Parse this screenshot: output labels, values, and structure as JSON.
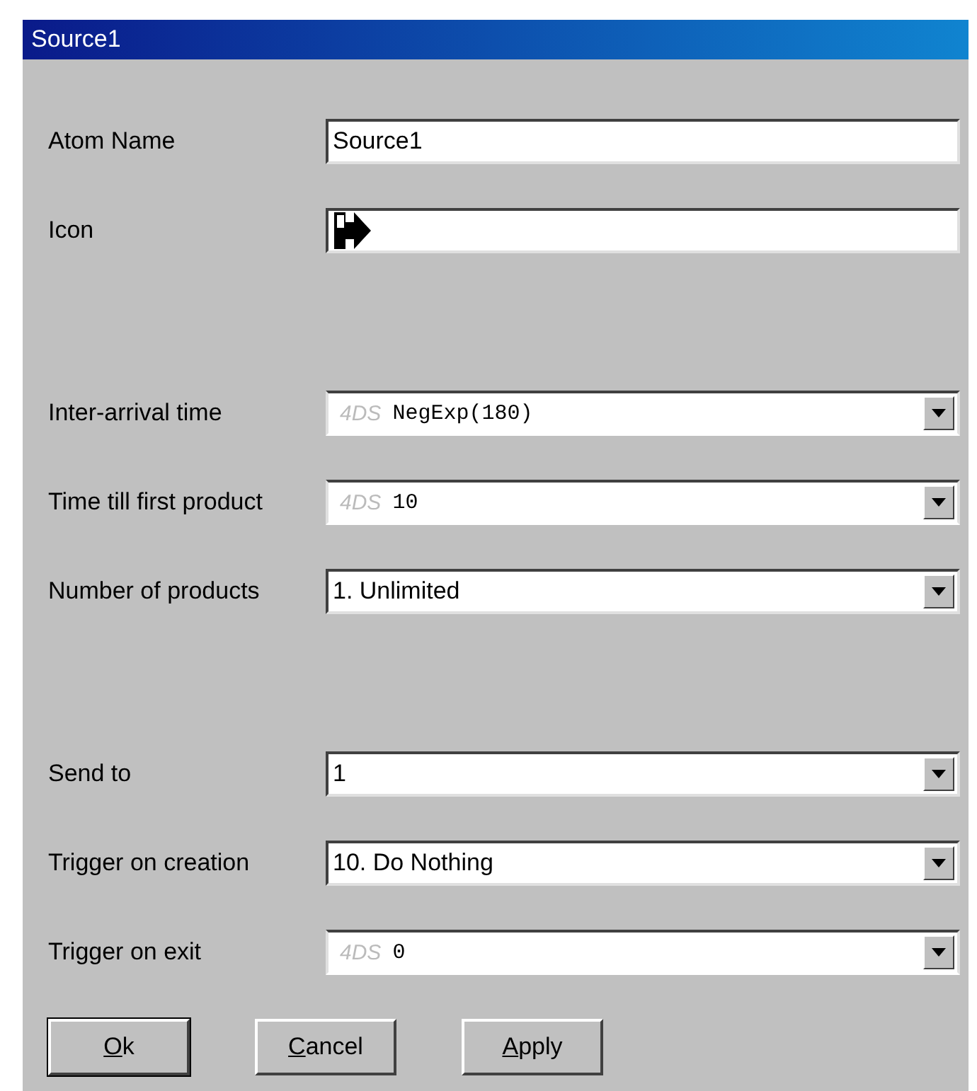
{
  "window": {
    "title": "Source1"
  },
  "groups": [
    [
      {
        "label": "Atom Name",
        "kind": "text",
        "value": "Source1"
      },
      {
        "label": "Icon",
        "kind": "icon"
      }
    ],
    [
      {
        "label": "Inter-arrival time",
        "kind": "prefixed",
        "prefix": "4DS",
        "value": "NegExp(180)"
      },
      {
        "label": "Time till first product",
        "kind": "prefixed",
        "prefix": "4DS",
        "value": "10"
      },
      {
        "label": "Number of products",
        "kind": "combo",
        "value": "1. Unlimited"
      }
    ],
    [
      {
        "label": "Send to",
        "kind": "combo",
        "value": "1"
      },
      {
        "label": "Trigger on creation",
        "kind": "combo",
        "value": "10. Do Nothing"
      },
      {
        "label": "Trigger on exit",
        "kind": "prefixed",
        "prefix": "4DS",
        "value": "0"
      }
    ]
  ],
  "buttons": [
    {
      "label": "Ok",
      "default": true
    },
    {
      "label": "Cancel",
      "default": false
    },
    {
      "label": "Apply",
      "default": false
    }
  ]
}
